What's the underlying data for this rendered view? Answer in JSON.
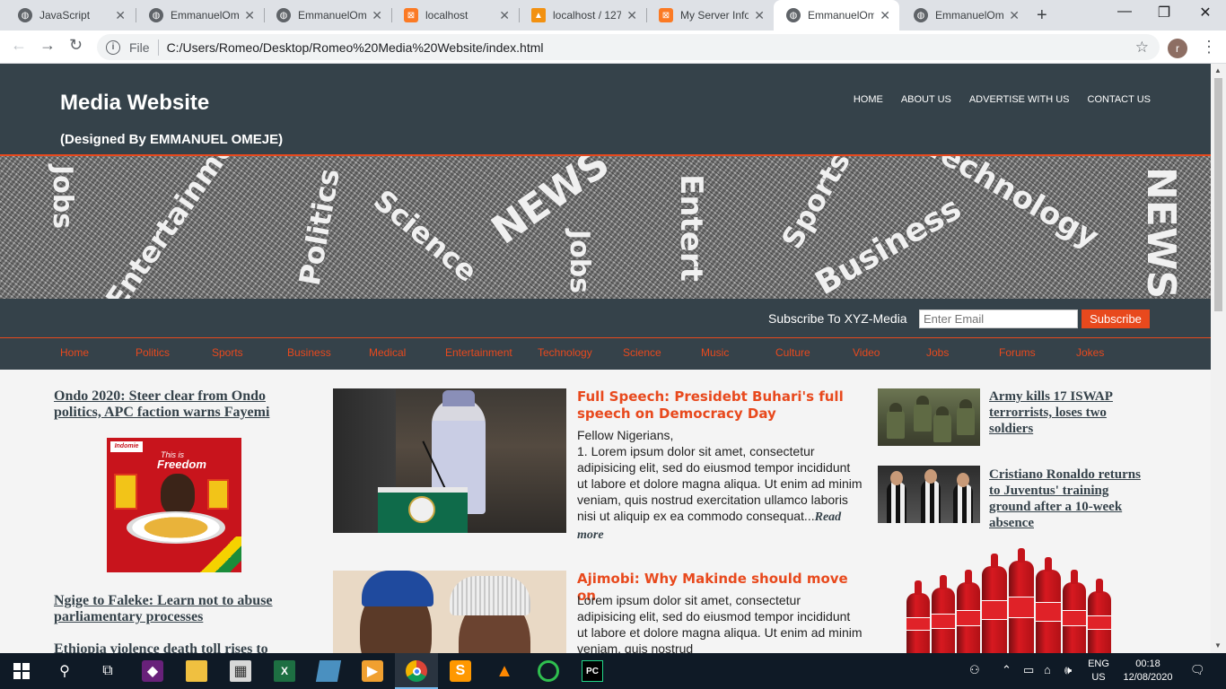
{
  "browser": {
    "tabs": [
      {
        "title": "JavaScript",
        "favicon": "globe-icon"
      },
      {
        "title": "EmmanuelOm",
        "favicon": "globe-icon"
      },
      {
        "title": "EmmanuelOm",
        "favicon": "globe-icon"
      },
      {
        "title": "localhost",
        "favicon": "xampp-icon"
      },
      {
        "title": "localhost / 127",
        "favicon": "phpmyadmin-icon"
      },
      {
        "title": "My Server Info",
        "favicon": "xampp-icon"
      },
      {
        "title": "EmmanuelOm",
        "favicon": "globe-icon",
        "active": true
      },
      {
        "title": "EmmanuelOm",
        "favicon": "globe-icon"
      }
    ],
    "address": {
      "scheme_label": "File",
      "url": "C:/Users/Romeo/Desktop/Romeo%20Media%20Website/index.html"
    },
    "profile_initial": "r"
  },
  "site": {
    "title": "Media Website",
    "subtitle": "(Designed By EMMANUEL OMEJE)",
    "top_nav": [
      "HOME",
      "ABOUT US",
      "ADVERTISE WITH US",
      "CONTACT US"
    ],
    "banner_words": [
      "Jobs",
      "Entertainment",
      "Politics",
      "Science",
      "NEWS",
      "Jobs",
      "Entert",
      "Sports",
      "Business",
      "Technology",
      "NEWS"
    ],
    "subscribe": {
      "label": "Subscribe To XYZ-Media",
      "placeholder": "Enter Email",
      "button": "Subscribe"
    },
    "categories": [
      "Home",
      "Politics",
      "Sports",
      "Business",
      "Medical",
      "Entertainment",
      "Technology",
      "Science",
      "Music",
      "Culture",
      "Video",
      "Jobs",
      "Forums",
      "Jokes"
    ],
    "left_stories": [
      "Ondo 2020: Steer clear from Ondo politics, APC faction warns Fayemi",
      "Ngige to Faleke: Learn not to abuse parliamentary processes",
      "Ethiopia violence death toll rises to"
    ],
    "ad": {
      "brand": "Indomie",
      "tagline_small": "This is",
      "tagline": "Freedom"
    },
    "articles": [
      {
        "headline": "Full Speech: Presidebt Buhari's full speech on Democracy Day",
        "salutation": "Fellow Nigerians,",
        "body": "1. Lorem ipsum dolor sit amet, consectetur adipisicing elit, sed do eiusmod tempor incididunt ut labore et dolore magna aliqua. Ut enim ad minim veniam, quis nostrud exercitation ullamco laboris nisi ut aliquip ex ea commodo consequat...",
        "read_more": "Read more"
      },
      {
        "headline": "Ajimobi: Why Makinde should move on",
        "body": "Lorem ipsum dolor sit amet, consectetur adipisicing elit, sed do eiusmod tempor incididunt ut labore et dolore magna aliqua. Ut enim ad minim veniam, quis nostrud"
      }
    ],
    "right_stories": [
      "Army kills 17 ISWAP terrorrists, loses two soldiers",
      "Cristiano Ronaldo returns to Juventus' training ground after a 10-week absence"
    ]
  },
  "taskbar": {
    "language": "ENG",
    "region": "US",
    "time": "00:18",
    "date": "12/08/2020"
  },
  "colors": {
    "header_bg": "#35424a",
    "accent": "#e8491d",
    "page_bg": "#f4f4f4"
  }
}
